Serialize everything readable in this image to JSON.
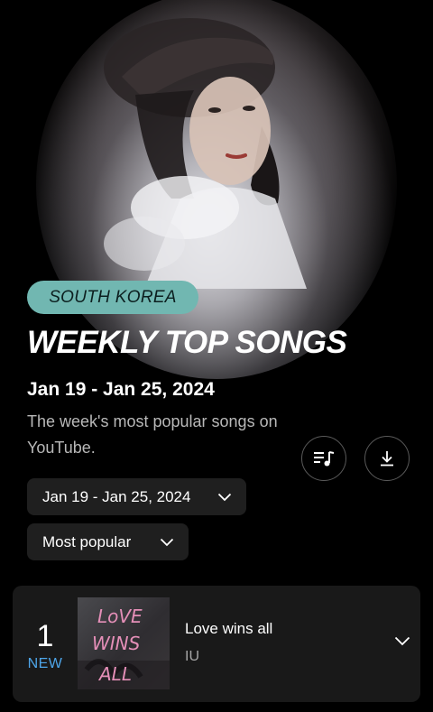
{
  "header": {
    "region": "SOUTH KOREA",
    "title": "WEEKLY TOP SONGS",
    "date_range": "Jan 19 - Jan 25, 2024",
    "description": "The week's most popular songs on YouTube."
  },
  "actions": {
    "queue_icon": "playlist-music-icon",
    "download_icon": "download-icon"
  },
  "filters": {
    "week": "Jan 19 - Jan 25, 2024",
    "sort": "Most popular"
  },
  "songs": [
    {
      "rank": "1",
      "change": "NEW",
      "title": "Love wins all",
      "artist": "IU",
      "cover_text": [
        "LoVE",
        "WINS",
        "ALL"
      ]
    }
  ],
  "colors": {
    "background": "#000000",
    "region_chip": "#71b7b1",
    "new_badge": "#4ea6ea",
    "card": "#191919",
    "dropdown": "#1f1f1f"
  }
}
